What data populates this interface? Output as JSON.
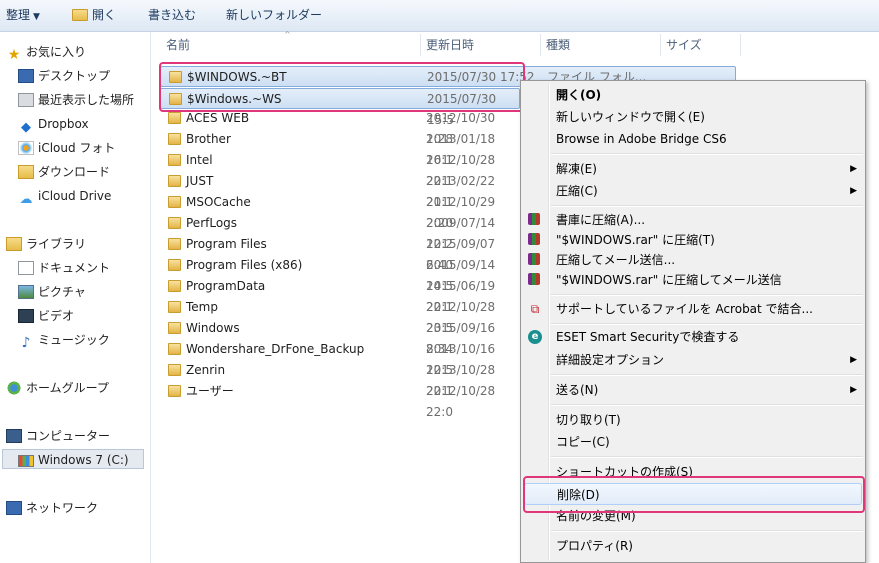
{
  "toolbar": {
    "organize": "整理",
    "open": "開く",
    "burn": "書き込む",
    "new_folder": "新しいフォルダー"
  },
  "nav": {
    "favorites": "お気に入り",
    "desktop": "デスクトップ",
    "recent": "最近表示した場所",
    "dropbox": "Dropbox",
    "icloud_photo": "iCloud フォト",
    "downloads": "ダウンロード",
    "icloud_drive": "iCloud Drive",
    "libraries": "ライブラリ",
    "documents": "ドキュメント",
    "pictures": "ピクチャ",
    "videos": "ビデオ",
    "music": "ミュージック",
    "homegroup": "ホームグループ",
    "computer": "コンピューター",
    "drive_c": "Windows 7 (C:)",
    "network": "ネットワーク"
  },
  "columns": {
    "name": "名前",
    "date": "更新日時",
    "type": "種類",
    "size": "サイズ"
  },
  "files": [
    {
      "name": "$WINDOWS.~BT",
      "date": "2015/07/30 17:52",
      "type": "ファイル フォル..."
    },
    {
      "name": "$Windows.~WS",
      "date": "2015/07/30 15:5"
    },
    {
      "name": "ACES WEB",
      "date": "2012/10/30 1:28"
    },
    {
      "name": "Brother",
      "date": "2013/01/18 16:1"
    },
    {
      "name": "Intel",
      "date": "2012/10/28 22:1"
    },
    {
      "name": "JUST",
      "date": "2013/02/22 21:1"
    },
    {
      "name": "MSOCache",
      "date": "2012/10/29 2:20"
    },
    {
      "name": "PerfLogs",
      "date": "2009/07/14 12:2"
    },
    {
      "name": "Program Files",
      "date": "2015/09/07 6:40"
    },
    {
      "name": "Program Files (x86)",
      "date": "2015/09/14 14:5"
    },
    {
      "name": "ProgramData",
      "date": "2015/06/19 22:1"
    },
    {
      "name": "Temp",
      "date": "2012/10/28 23:5"
    },
    {
      "name": "Windows",
      "date": "2015/09/16 8:34"
    },
    {
      "name": "Wondershare_DrFone_Backup",
      "date": "2013/10/16 12:5"
    },
    {
      "name": "Zenrin",
      "date": "2013/10/28 22:1"
    },
    {
      "name": "ユーザー",
      "date": "2012/10/28 22:0"
    }
  ],
  "menu": {
    "open": "開く(O)",
    "open_new_window": "新しいウィンドウで開く(E)",
    "browse_bridge": "Browse in Adobe Bridge CS6",
    "extract": "解凍(E)",
    "compress": "圧縮(C)",
    "add_archive": "書庫に圧縮(A)...",
    "compress_rar": "\"$WINDOWS.rar\" に圧縮(T)",
    "compress_email": "圧縮してメール送信...",
    "compress_rar_email": "\"$WINDOWS.rar\" に圧縮してメール送信",
    "acrobat_combine": "サポートしているファイルを Acrobat で結合...",
    "eset_scan": "ESET Smart Securityで検査する",
    "advanced_options": "詳細設定オプション",
    "send_to": "送る(N)",
    "cut": "切り取り(T)",
    "copy": "コピー(C)",
    "create_shortcut": "ショートカットの作成(S)",
    "delete": "削除(D)",
    "rename": "名前の変更(M)",
    "properties": "プロパティ(R)"
  },
  "colors": {
    "highlight": "#e0367a",
    "selection": "#cddff3",
    "folder": "#e7bc4a"
  }
}
